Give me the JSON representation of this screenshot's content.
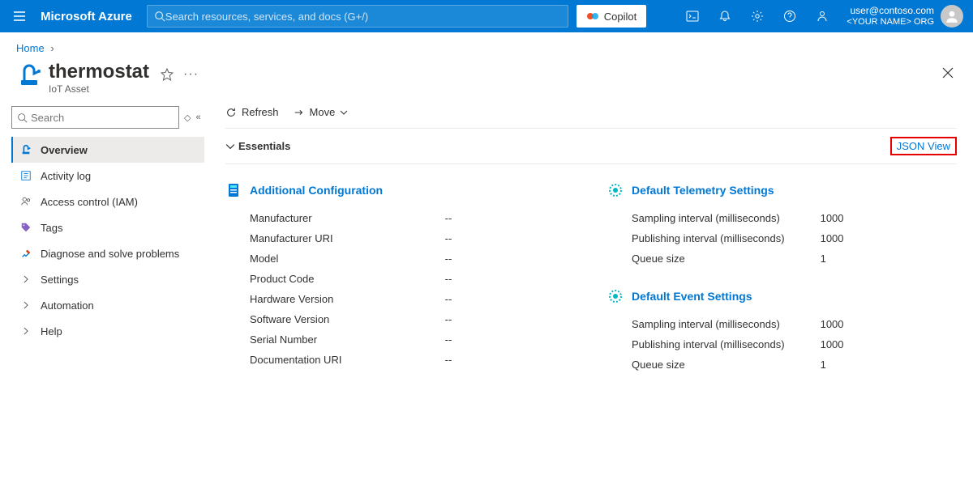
{
  "topbar": {
    "brand": "Microsoft Azure",
    "search_placeholder": "Search resources, services, and docs (G+/)",
    "copilot": "Copilot",
    "user_email": "user@contoso.com",
    "user_org": "<YOUR NAME> ORG"
  },
  "breadcrumb": {
    "home": "Home"
  },
  "title": {
    "name": "thermostat",
    "subtitle": "IoT Asset"
  },
  "sidebar": {
    "search_placeholder": "Search",
    "items": [
      {
        "label": "Overview"
      },
      {
        "label": "Activity log"
      },
      {
        "label": "Access control (IAM)"
      },
      {
        "label": "Tags"
      },
      {
        "label": "Diagnose and solve problems"
      },
      {
        "label": "Settings"
      },
      {
        "label": "Automation"
      },
      {
        "label": "Help"
      }
    ]
  },
  "toolbar": {
    "refresh": "Refresh",
    "move": "Move"
  },
  "essentials": {
    "label": "Essentials",
    "json_view": "JSON View"
  },
  "sections": {
    "additional": {
      "title": "Additional Configuration",
      "rows": [
        {
          "k": "Manufacturer",
          "v": "--"
        },
        {
          "k": "Manufacturer URI",
          "v": "--"
        },
        {
          "k": "Model",
          "v": "--"
        },
        {
          "k": "Product Code",
          "v": "--"
        },
        {
          "k": "Hardware Version",
          "v": "--"
        },
        {
          "k": "Software Version",
          "v": "--"
        },
        {
          "k": "Serial Number",
          "v": "--"
        },
        {
          "k": "Documentation URI",
          "v": "--"
        }
      ]
    },
    "telemetry": {
      "title": "Default Telemetry Settings",
      "rows": [
        {
          "k": "Sampling interval (milliseconds)",
          "v": "1000"
        },
        {
          "k": "Publishing interval (milliseconds)",
          "v": "1000"
        },
        {
          "k": "Queue size",
          "v": "1"
        }
      ]
    },
    "event": {
      "title": "Default Event Settings",
      "rows": [
        {
          "k": "Sampling interval (milliseconds)",
          "v": "1000"
        },
        {
          "k": "Publishing interval (milliseconds)",
          "v": "1000"
        },
        {
          "k": "Queue size",
          "v": "1"
        }
      ]
    }
  }
}
